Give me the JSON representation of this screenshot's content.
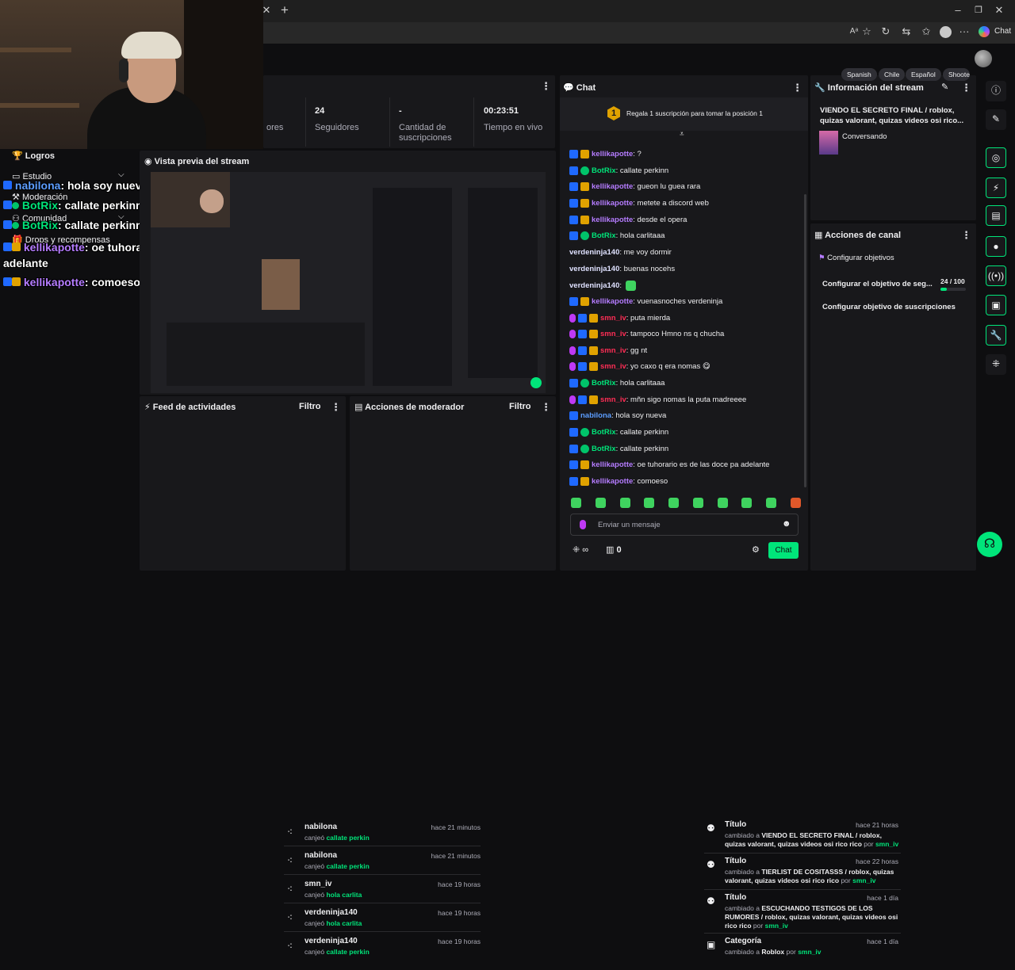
{
  "browser": {
    "copilot_label": "Chat"
  },
  "overlay_chat": [
    {
      "user": "nabilona",
      "text": ": hola soy nueva"
    },
    {
      "user": "BotRix",
      "text": ": callate perkinn"
    },
    {
      "user": "BotRix",
      "text": ": callate perkinn"
    },
    {
      "user": "kellikapotte",
      "text": ": oe tuhorario es de las doce pa adelante"
    },
    {
      "user": "kellikapotte",
      "text": ": comoeso"
    }
  ],
  "sidebar": {
    "items": [
      "Logros",
      "Estudio",
      "Moderación",
      "Comunidad",
      "Drops y recompensas"
    ]
  },
  "stats": [
    {
      "value": "",
      "label": "ores"
    },
    {
      "value": "24",
      "label": "Seguidores"
    },
    {
      "value": "-",
      "label": "Cantidad de suscripciones"
    },
    {
      "value": "00:23:51",
      "label": "Tiempo en vivo"
    }
  ],
  "preview": {
    "title": "Vista previa del stream"
  },
  "activity_feed": {
    "title": "Feed de actividades",
    "filter": "Filtro",
    "items": [
      {
        "name": "nabilona",
        "time": "hace 21 minutos",
        "action": "canjeó",
        "reward": "callate perkin"
      },
      {
        "name": "nabilona",
        "time": "hace 21 minutos",
        "action": "canjeó",
        "reward": "callate perkin"
      },
      {
        "name": "smn_iv",
        "time": "hace 19 horas",
        "action": "canjeó",
        "reward": "hola carlita"
      },
      {
        "name": "verdeninja140",
        "time": "hace 19 horas",
        "action": "canjeó",
        "reward": "hola carlita"
      },
      {
        "name": "verdeninja140",
        "time": "hace 19 horas",
        "action": "canjeó",
        "reward": "callate perkin"
      }
    ]
  },
  "mod_actions": {
    "title": "Acciones de moderador",
    "filter": "Filtro",
    "items": [
      {
        "kind": "Título",
        "time": "hace 21 horas",
        "prefix": "cambiado a",
        "value": "VIENDO EL SECRETO FINAL / roblox, quizas valorant, quizas videos osi rico rico",
        "by": "por",
        "mod": "smn_iv"
      },
      {
        "kind": "Título",
        "time": "hace 22 horas",
        "prefix": "cambiado a",
        "value": "TIERLIST DE COSITASSS / roblox, quizas valorant, quizas videos osi rico rico",
        "by": "por",
        "mod": "smn_iv"
      },
      {
        "kind": "Título",
        "time": "hace 1 día",
        "prefix": "cambiado a",
        "value": "ESCUCHANDO TESTIGOS DE LOS RUMORES / roblox, quizas valorant, quizas videos osi rico rico",
        "by": "por",
        "mod": "smn_iv"
      },
      {
        "kind": "Categoría",
        "time": "hace 1 día",
        "prefix": "cambiado a",
        "value": "Roblox",
        "by": "por",
        "mod": "smn_iv"
      }
    ]
  },
  "chat": {
    "title": "Chat",
    "gift_number": "1",
    "gift_text": "Regala 1 suscripción para tomar la posición 1",
    "messages": [
      {
        "user": "kellikapotte",
        "color": "pur",
        "badges": [
          "tw",
          "cr"
        ],
        "text": ": ?"
      },
      {
        "user": "BotRix",
        "color": "grn",
        "badges": [
          "tw",
          "bot"
        ],
        "text": ": callate perkinn"
      },
      {
        "user": "kellikapotte",
        "color": "pur",
        "badges": [
          "tw",
          "cr"
        ],
        "text": ": gueon lu guea rara"
      },
      {
        "user": "kellikapotte",
        "color": "pur",
        "badges": [
          "tw",
          "cr"
        ],
        "text": ": metete a discord web"
      },
      {
        "user": "kellikapotte",
        "color": "pur",
        "badges": [
          "tw",
          "cr"
        ],
        "text": ": desde el opera"
      },
      {
        "user": "BotRix",
        "color": "grn",
        "badges": [
          "tw",
          "bot"
        ],
        "text": ": hola carlitaaa"
      },
      {
        "user": "verdeninja140",
        "color": "wht",
        "badges": [],
        "text": ": me voy dormir"
      },
      {
        "user": "verdeninja140",
        "color": "wht",
        "badges": [],
        "text": ": buenas nocehs"
      },
      {
        "user": "verdeninja140",
        "color": "wht",
        "badges": [],
        "text": ":",
        "emote": true
      },
      {
        "user": "kellikapotte",
        "color": "pur",
        "badges": [
          "tw",
          "cr"
        ],
        "text": ": vuenasnoches verdeninja"
      },
      {
        "user": "smn_iv",
        "color": "red",
        "badges": [
          "mic",
          "tw",
          "cr"
        ],
        "text": ": puta mierda"
      },
      {
        "user": "smn_iv",
        "color": "red",
        "badges": [
          "mic",
          "tw",
          "cr"
        ],
        "text": ": tampoco Hmno ns q chucha"
      },
      {
        "user": "smn_iv",
        "color": "red",
        "badges": [
          "mic",
          "tw",
          "cr"
        ],
        "text": ": gg nt"
      },
      {
        "user": "smn_iv",
        "color": "red",
        "badges": [
          "mic",
          "tw",
          "cr"
        ],
        "text": ": yo caxo q era nomas 😋"
      },
      {
        "user": "BotRix",
        "color": "grn",
        "badges": [
          "tw",
          "bot"
        ],
        "text": ": hola carlitaaa"
      },
      {
        "user": "smn_iv",
        "color": "red",
        "badges": [
          "mic",
          "tw",
          "cr"
        ],
        "text": ": mñn sigo nomas la puta madreeee"
      },
      {
        "user": "nabilona",
        "color": "blu",
        "badges": [
          "tw"
        ],
        "text": ": hola soy nueva"
      },
      {
        "user": "BotRix",
        "color": "grn",
        "badges": [
          "tw",
          "bot"
        ],
        "text": ": callate perkinn"
      },
      {
        "user": "BotRix",
        "color": "grn",
        "badges": [
          "tw",
          "bot"
        ],
        "text": ": callate perkinn"
      },
      {
        "user": "kellikapotte",
        "color": "pur",
        "badges": [
          "tw",
          "cr"
        ],
        "text": ": oe tuhorario es de las doce pa adelante"
      },
      {
        "user": "kellikapotte",
        "color": "pur",
        "badges": [
          "tw",
          "cr"
        ],
        "text": ": comoeso"
      }
    ],
    "input_placeholder": "Enviar un mensaje",
    "points": "0",
    "send_label": "Chat"
  },
  "stream_info": {
    "title": "Información del stream",
    "stream_title": "VIENDO EL SECRETO FINAL / roblox, quizas valorant, quizas videos osi rico...",
    "category": "Conversando",
    "tags": [
      "Spanish",
      "Chile",
      "Español",
      "Shoote"
    ]
  },
  "channel_actions": {
    "title": "Acciones de canal",
    "goals_label": "Configurar objetivos",
    "follower_goal": "Configurar el objetivo de seg...",
    "follower_progress_text": "24 / 100",
    "follower_progress": 0.24,
    "sub_goal": "Configurar objetivo de suscripciones"
  },
  "colors": {
    "accent": "#00e57a",
    "background": "#0e0e10",
    "panel": "#18181b"
  }
}
